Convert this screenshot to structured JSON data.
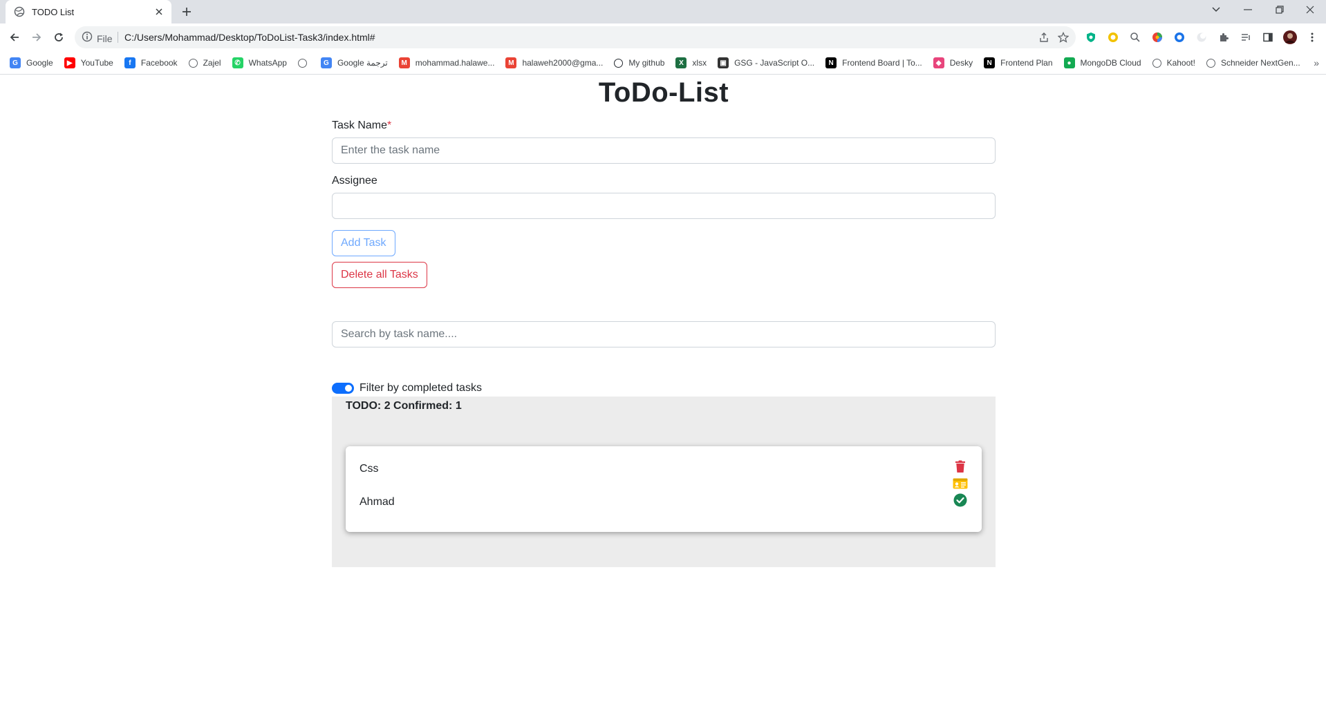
{
  "browser": {
    "tab_title": "TODO List",
    "site_info_label": "File",
    "url": "C:/Users/Mohammad/Desktop/ToDoList-Task3/index.html#",
    "bookmarks": [
      {
        "label": "Google",
        "icon": "google-icon",
        "color": "#4285f4"
      },
      {
        "label": "YouTube",
        "icon": "youtube-icon",
        "color": "#ff0000"
      },
      {
        "label": "Facebook",
        "icon": "facebook-icon",
        "color": "#1877f2"
      },
      {
        "label": "Zajel",
        "icon": "globe-icon",
        "color": "#5f6368"
      },
      {
        "label": "WhatsApp",
        "icon": "whatsapp-icon",
        "color": "#25d366"
      },
      {
        "label": "",
        "icon": "globe-icon",
        "color": "#5f6368"
      },
      {
        "label": "Google ترجمة",
        "icon": "translate-icon",
        "color": "#4285f4"
      },
      {
        "label": "mohammad.halawe...",
        "icon": "gmail-icon",
        "color": "#ea4335"
      },
      {
        "label": "halaweh2000@gma...",
        "icon": "gmail-icon",
        "color": "#ea4335"
      },
      {
        "label": "My github",
        "icon": "github-icon",
        "color": "#24292f"
      },
      {
        "label": "xlsx",
        "icon": "excel-icon",
        "color": "#1d6f42"
      },
      {
        "label": "GSG - JavaScript O...",
        "icon": "gsg-icon",
        "color": "#333333"
      },
      {
        "label": "Frontend Board | To...",
        "icon": "notion-icon",
        "color": "#000000"
      },
      {
        "label": "Desky",
        "icon": "desky-icon",
        "color": "#e8457c"
      },
      {
        "label": "Frontend Plan",
        "icon": "notion-icon",
        "color": "#000000"
      },
      {
        "label": "MongoDB Cloud",
        "icon": "mongodb-icon",
        "color": "#13aa52"
      },
      {
        "label": "Kahoot!",
        "icon": "globe-icon",
        "color": "#5f6368"
      },
      {
        "label": "Schneider NextGen...",
        "icon": "globe-icon",
        "color": "#5f6368"
      }
    ],
    "bookmarks_more": "»"
  },
  "app": {
    "title": "ToDo-List",
    "task_name_label": "Task Name",
    "required_mark": "*",
    "task_name_placeholder": "Enter the task name",
    "task_name_value": "",
    "assignee_label": "Assignee",
    "assignee_value": "",
    "add_button": "Add Task",
    "delete_all_button": "Delete all Tasks",
    "search_placeholder": "Search by task name....",
    "search_value": "",
    "filter_label": "Filter by completed tasks",
    "filter_enabled": true,
    "counts_text": "TODO: 2 Confirmed: 1",
    "colors": {
      "primary": "#6ea8fe",
      "danger": "#dc3545",
      "switch_on": "#0d6efd",
      "trash": "#dc3545",
      "edit": "#ffc107",
      "complete": "#198754"
    },
    "tasks": [
      {
        "name": "Css",
        "assignee": "Ahmad",
        "actions": [
          "trash-icon",
          "id-card-icon",
          "check-circle-icon"
        ]
      }
    ]
  }
}
